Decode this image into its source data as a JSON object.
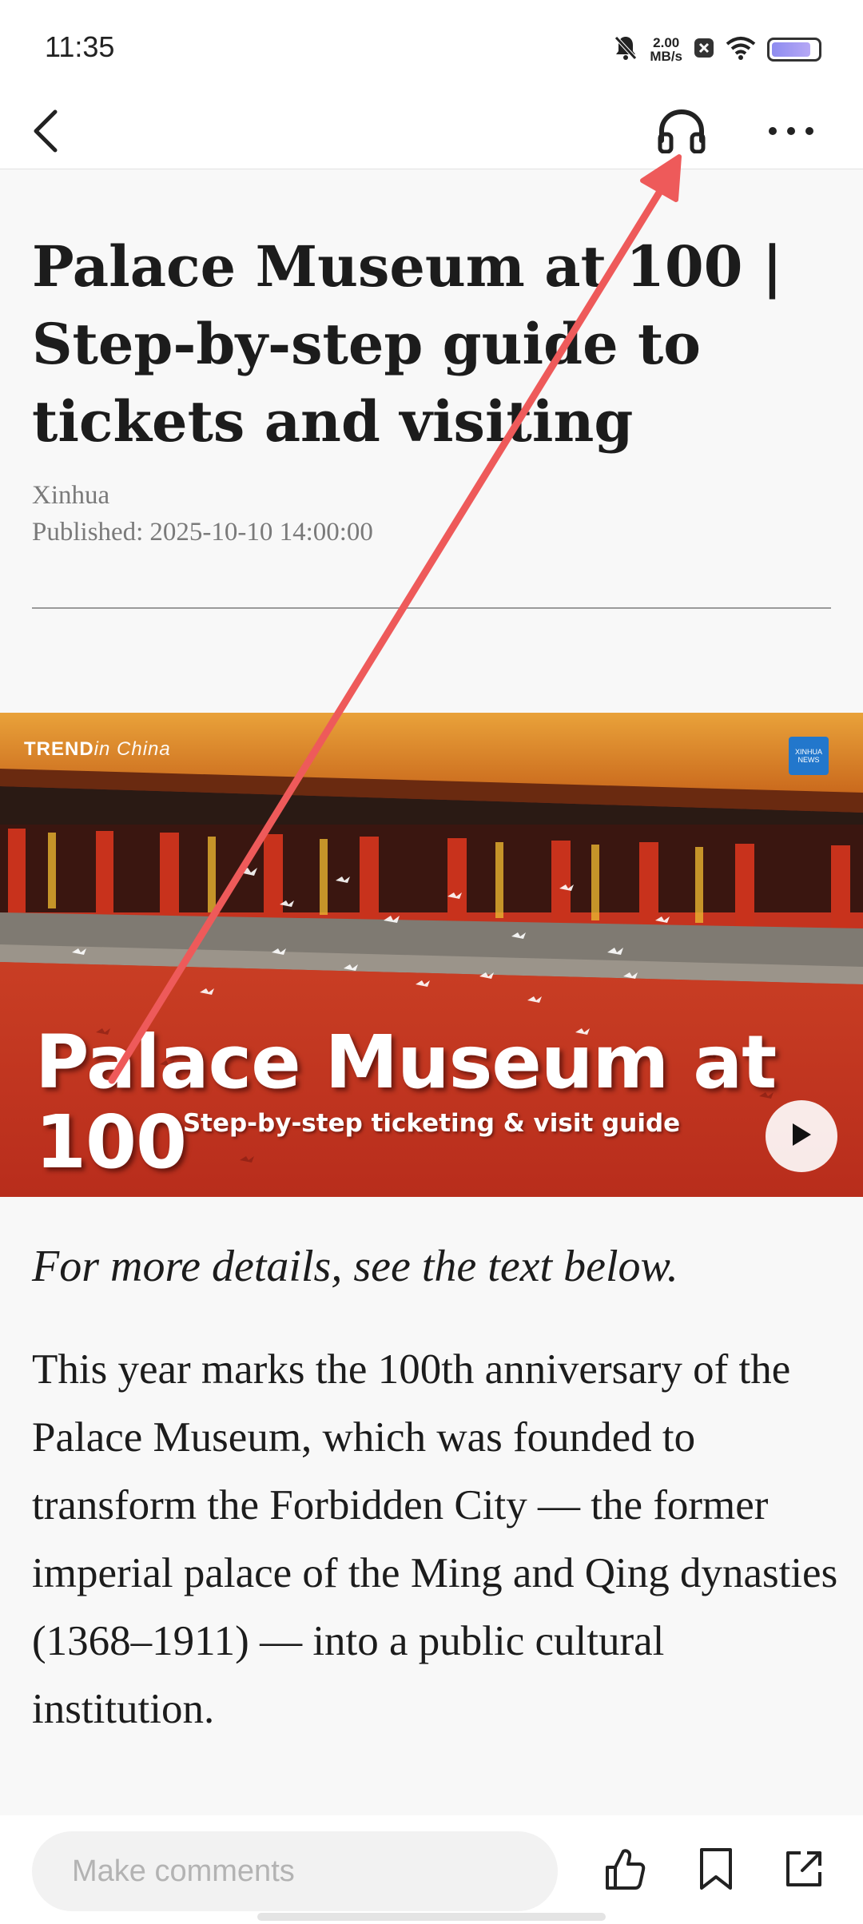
{
  "status_bar": {
    "time": "11:35",
    "net_speed_value": "2.00",
    "net_speed_unit": "MB/s",
    "icons": [
      "bell-muted-icon",
      "close-box-icon",
      "wifi-icon",
      "battery-icon"
    ]
  },
  "nav": {
    "icons": [
      "back-arrow-icon",
      "headphones-icon",
      "more-icon"
    ]
  },
  "article": {
    "title": "Palace Museum at 100 | Step-by-step guide to tickets and visiting",
    "source": "Xinhua",
    "published_label": "Published:",
    "published_date": "2025-10-10 14:00:00",
    "video": {
      "brand_bold": "TREND",
      "brand_rest": "in China",
      "logo_top": "XINHUA",
      "logo_bottom": "NEWS",
      "title": "Palace Museum at 100",
      "subtitle": "Step-by-step ticketing & visit guide"
    },
    "lead": "For more details, see the text below.",
    "body": "This year marks the 100th anniversary of the Palace Museum, which was founded to transform the Forbidden City — the former imperial palace of the Ming and Qing dynasties (1368–1911) — into a public cultural institution."
  },
  "bottom_bar": {
    "comment_placeholder": "Make comments",
    "icons": [
      "thumbs-up-icon",
      "bookmark-icon",
      "share-icon"
    ]
  },
  "colors": {
    "accent_red": "#c4331f",
    "annotation_arrow": "#ee5a5a",
    "text": "#1c1c1c",
    "meta_text": "#7a7a7a"
  }
}
